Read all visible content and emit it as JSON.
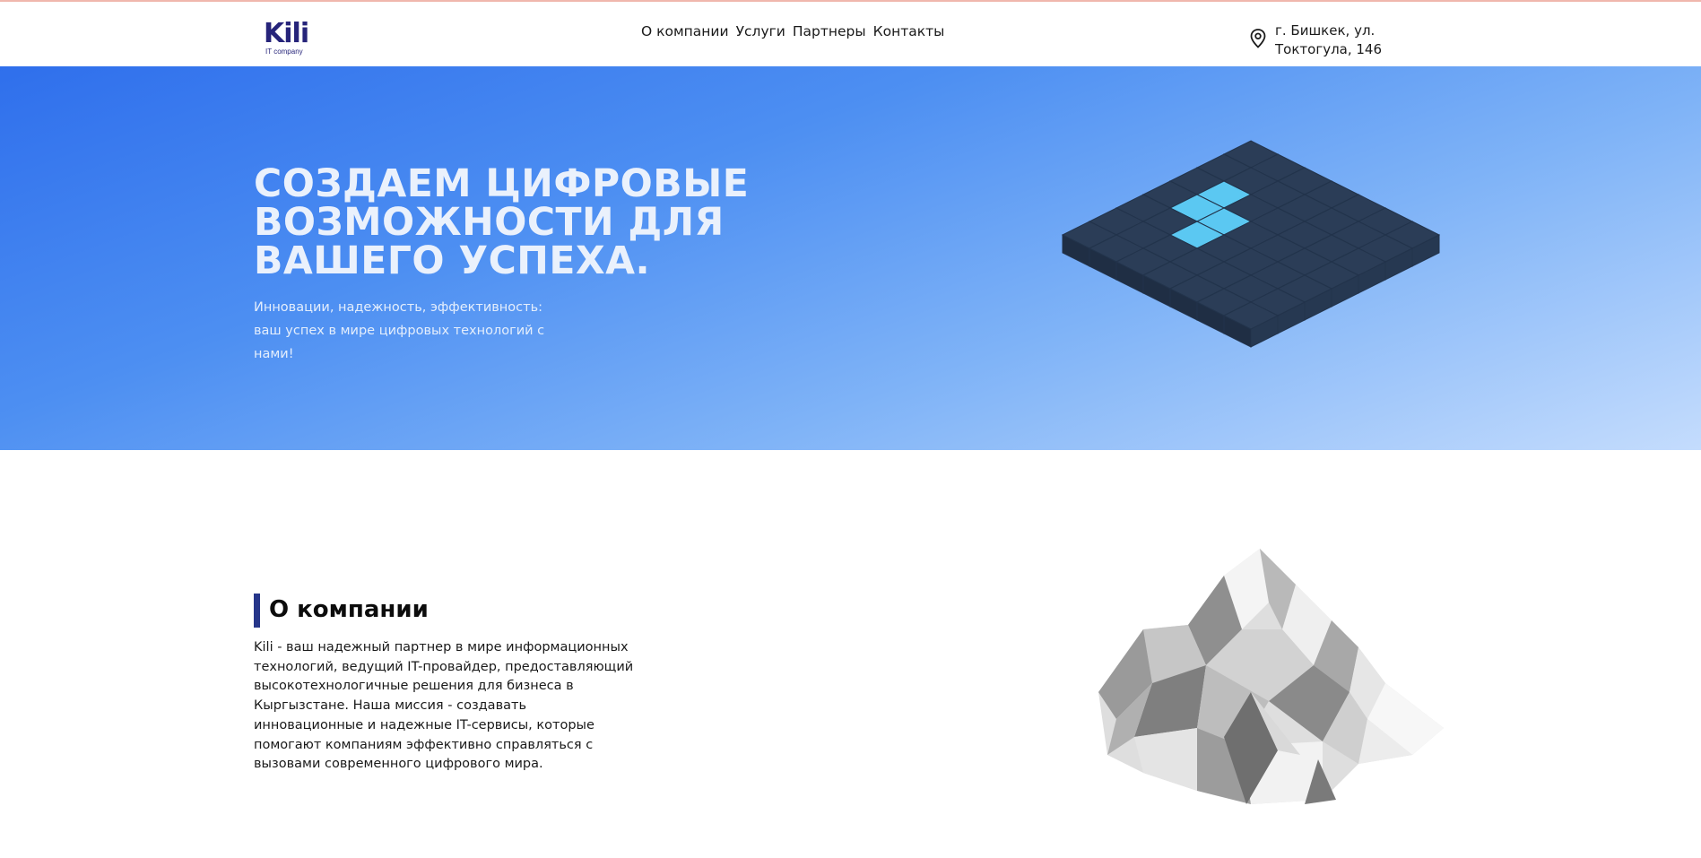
{
  "header": {
    "logo_text": "Kili",
    "logo_subtext": "IT company",
    "nav": [
      {
        "label": "О компании"
      },
      {
        "label": "Услуги"
      },
      {
        "label": "Партнеры"
      },
      {
        "label": "Контакты"
      }
    ],
    "address_icon": "map-pin-icon",
    "address": "г. Бишкек, ул. Токтогула, 146"
  },
  "hero": {
    "title": "СОЗДАЕМ ЦИФРОВЫЕ ВОЗМОЖНОСТИ ДЛЯ ВАШЕГО УСПЕХА.",
    "subtitle": "Инновации, надежность, эффективность: ваш успех в мире цифровых технологий с нами!",
    "illustration": "isometric-cube-grid"
  },
  "about": {
    "title": "О компании",
    "text": "Kili - ваш надежный партнер в мире информационных технологий, ведущий IT-провайдер, предоставляющий высокотехнологичные решения для бизнеса в Кыргызстане. Наша миссия - создавать инновационные и надежные IT-сервисы, которые помогают компаниям эффективно справляться с вызовами современного цифрового мира.",
    "illustration": "low-poly-mountain"
  },
  "colors": {
    "brand": "#26247a",
    "accent_bar": "#26368a",
    "hero_gradient_start": "#2f6fec",
    "hero_gradient_end": "#c4dcfd",
    "cube": "#2b3d57",
    "cube_highlight": "#5bc8f2"
  }
}
